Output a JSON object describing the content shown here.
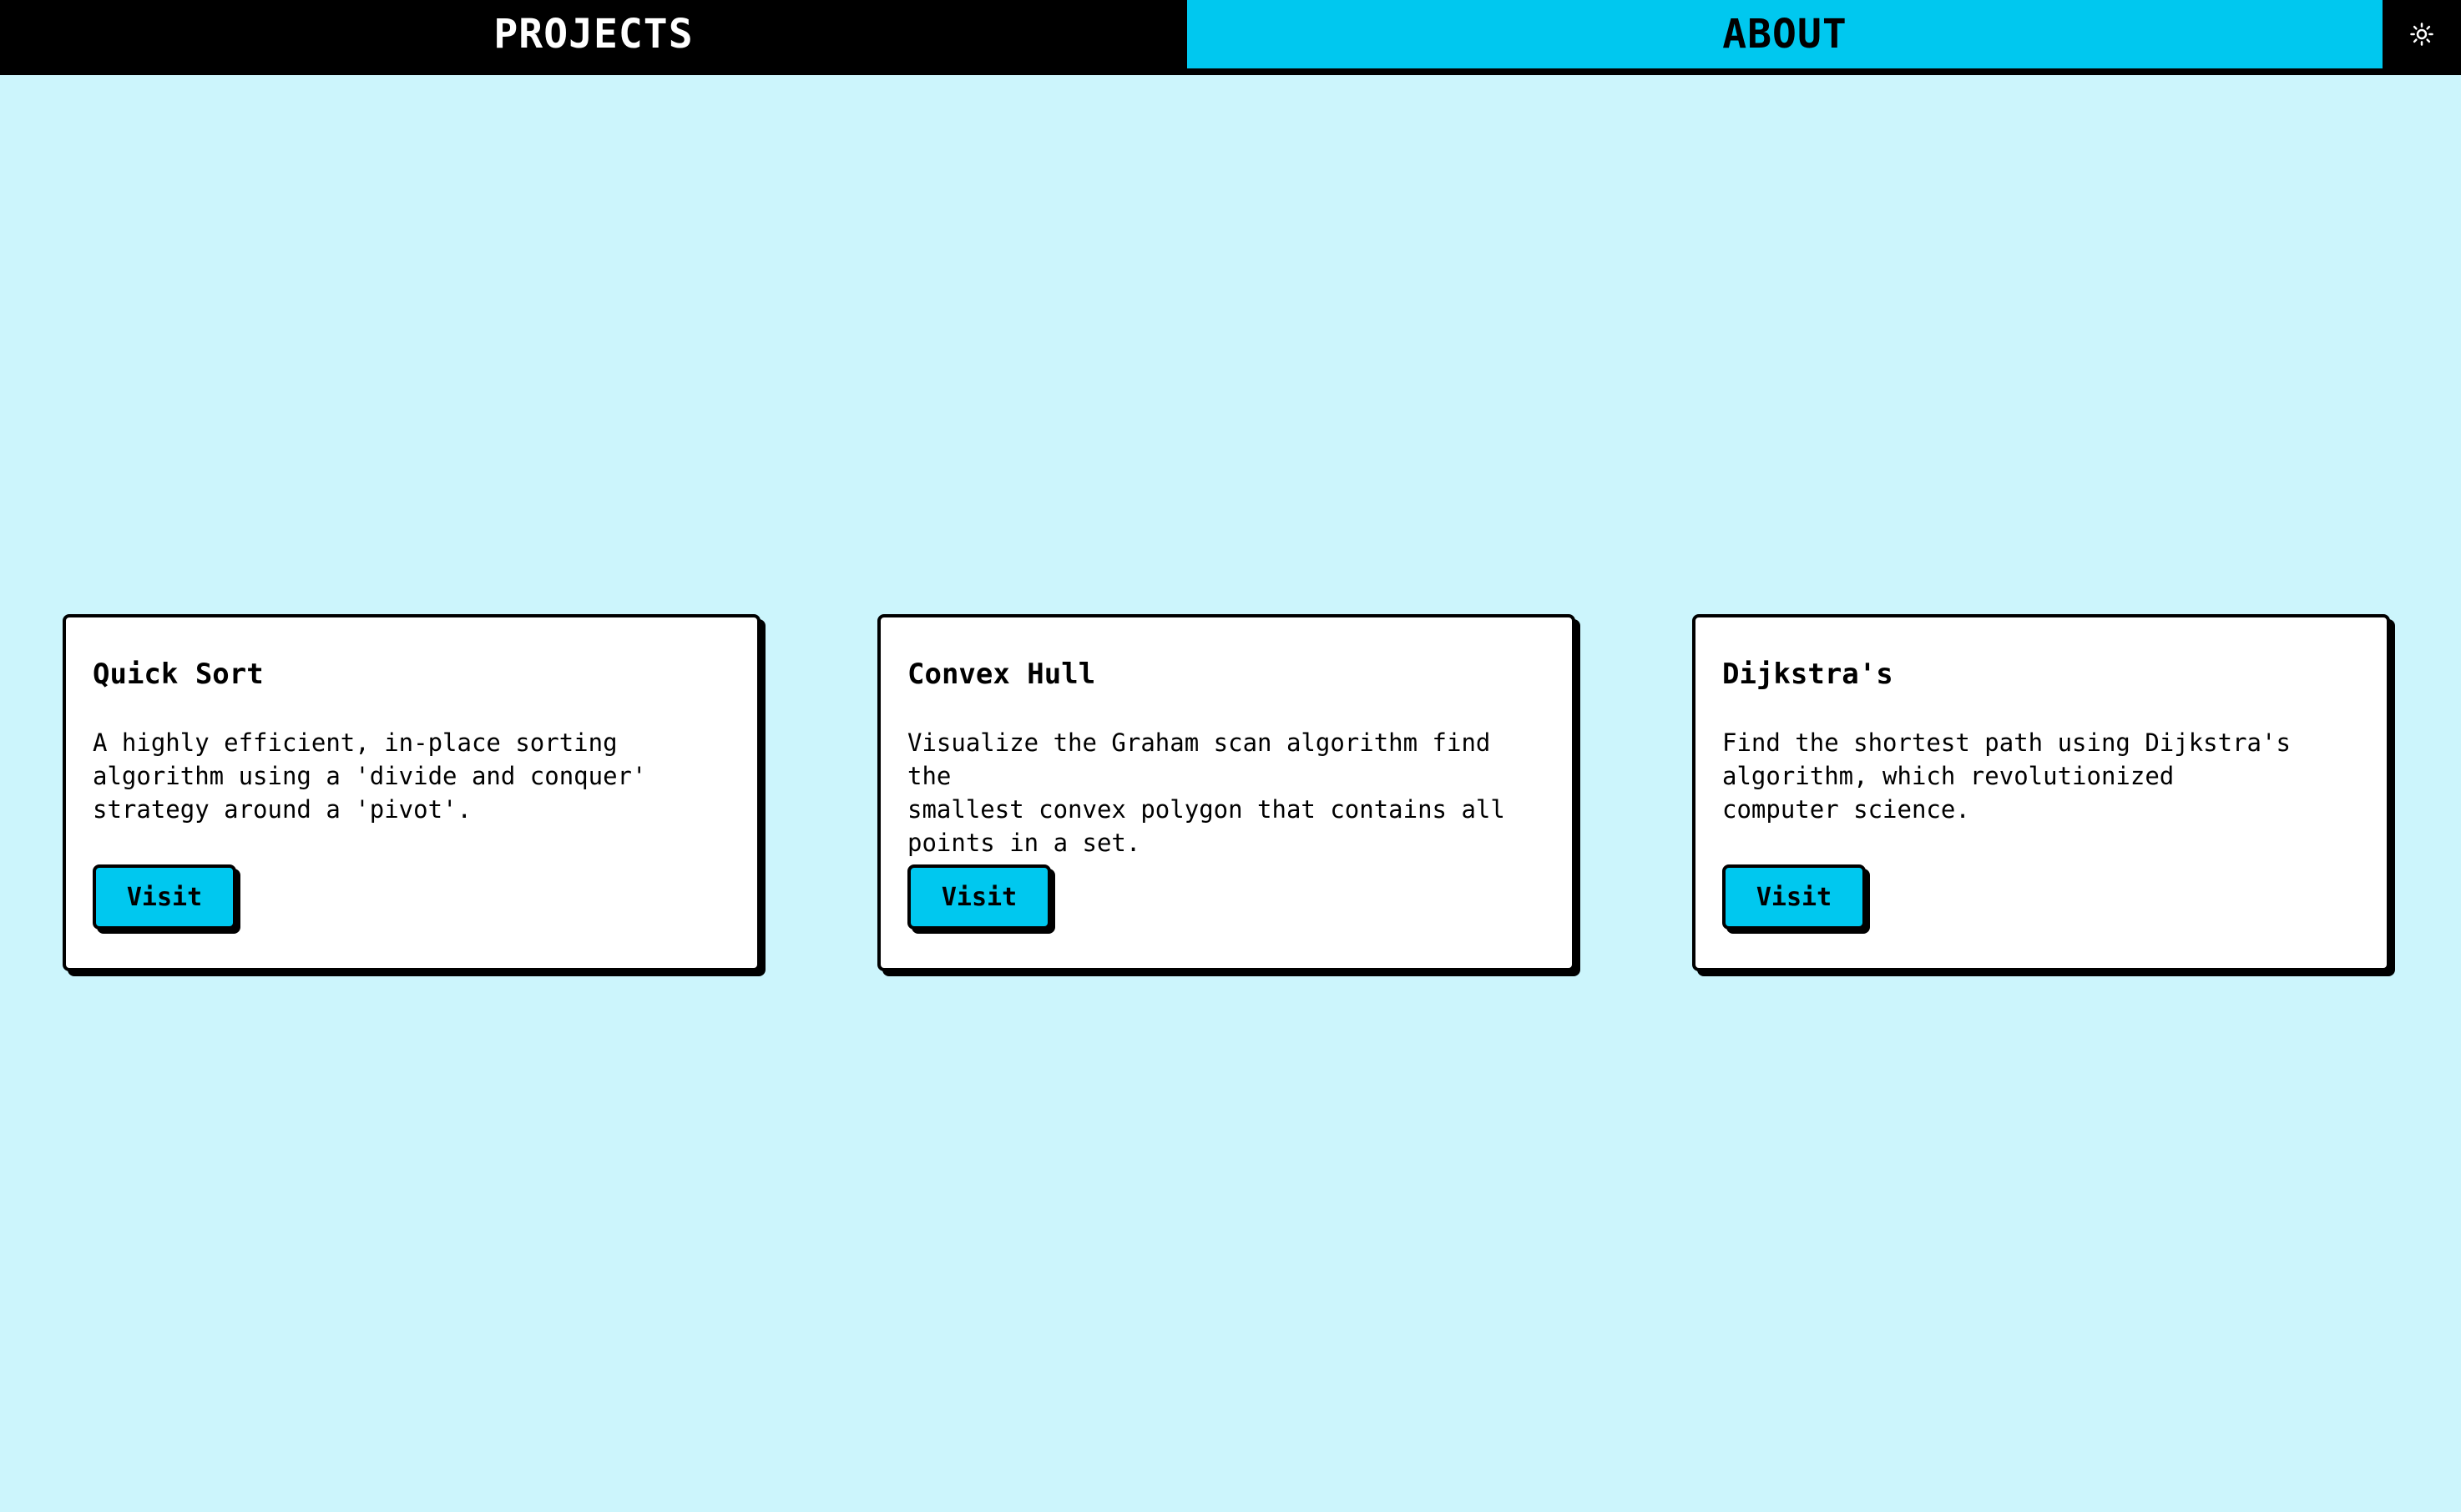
{
  "nav": {
    "projects_label": "PROJECTS",
    "about_label": "ABOUT",
    "theme_icon": "sun-icon"
  },
  "colors": {
    "background": "#ccf5fc",
    "accent": "#00c8ef",
    "nav_bar": "#000000",
    "card": "#ffffff"
  },
  "projects": [
    {
      "title": "Quick Sort",
      "description": "A highly efficient, in-place sorting\nalgorithm using a 'divide and conquer'\nstrategy around a 'pivot'.",
      "button_label": "Visit"
    },
    {
      "title": "Convex Hull",
      "description": "Visualize the Graham scan algorithm find the\nsmallest convex polygon that contains all\npoints in a set.",
      "button_label": "Visit"
    },
    {
      "title": "Dijkstra's",
      "description": "Find the shortest path using Dijkstra's\nalgorithm, which revolutionized\ncomputer science.",
      "button_label": "Visit"
    }
  ]
}
